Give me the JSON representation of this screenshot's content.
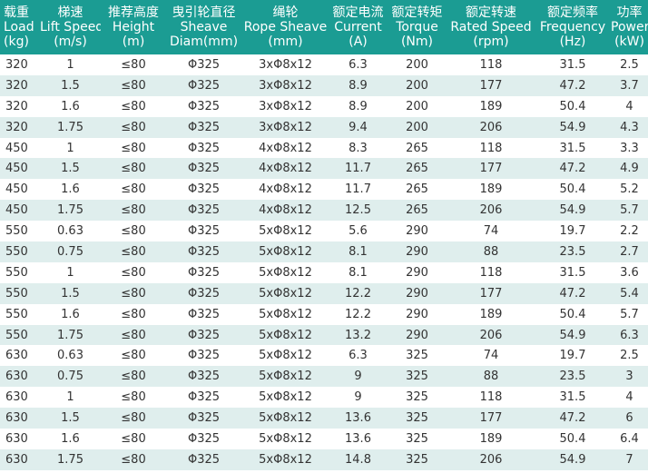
{
  "headers": [
    {
      "zh": "载重",
      "en1": "Load",
      "en2": "(kg)"
    },
    {
      "zh": "梯速",
      "en1": "Lift Speed",
      "en2": "(m/s)"
    },
    {
      "zh": "推荐高度",
      "en1": "Height",
      "en2": "(m)"
    },
    {
      "zh": "曳引轮直径",
      "en1": "Sheave",
      "en2": "Diam(mm)"
    },
    {
      "zh": "绳轮",
      "en1": "Rope Sheave",
      "en2": "(mm)"
    },
    {
      "zh": "额定电流",
      "en1": "Current",
      "en2": "(A)"
    },
    {
      "zh": "额定转矩",
      "en1": "Torque",
      "en2": "(Nm)"
    },
    {
      "zh": "额定转速",
      "en1": "Rated Speed",
      "en2": "(rpm)"
    },
    {
      "zh": "额定频率",
      "en1": "Frequency",
      "en2": "(Hz)"
    },
    {
      "zh": "功率",
      "en1": "Power",
      "en2": "(kW)"
    }
  ],
  "rows": [
    [
      "320",
      "1",
      "≤80",
      "Φ325",
      "3xΦ8x12",
      "6.3",
      "200",
      "118",
      "31.5",
      "2.5"
    ],
    [
      "320",
      "1.5",
      "≤80",
      "Φ325",
      "3xΦ8x12",
      "8.9",
      "200",
      "177",
      "47.2",
      "3.7"
    ],
    [
      "320",
      "1.6",
      "≤80",
      "Φ325",
      "3xΦ8x12",
      "8.9",
      "200",
      "189",
      "50.4",
      "4"
    ],
    [
      "320",
      "1.75",
      "≤80",
      "Φ325",
      "3xΦ8x12",
      "9.4",
      "200",
      "206",
      "54.9",
      "4.3"
    ],
    [
      "450",
      "1",
      "≤80",
      "Φ325",
      "4xΦ8x12",
      "8.3",
      "265",
      "118",
      "31.5",
      "3.3"
    ],
    [
      "450",
      "1.5",
      "≤80",
      "Φ325",
      "4xΦ8x12",
      "11.7",
      "265",
      "177",
      "47.2",
      "4.9"
    ],
    [
      "450",
      "1.6",
      "≤80",
      "Φ325",
      "4xΦ8x12",
      "11.7",
      "265",
      "189",
      "50.4",
      "5.2"
    ],
    [
      "450",
      "1.75",
      "≤80",
      "Φ325",
      "4xΦ8x12",
      "12.5",
      "265",
      "206",
      "54.9",
      "5.7"
    ],
    [
      "550",
      "0.63",
      "≤80",
      "Φ325",
      "5xΦ8x12",
      "5.6",
      "290",
      "74",
      "19.7",
      "2.2"
    ],
    [
      "550",
      "0.75",
      "≤80",
      "Φ325",
      "5xΦ8x12",
      "8.1",
      "290",
      "88",
      "23.5",
      "2.7"
    ],
    [
      "550",
      "1",
      "≤80",
      "Φ325",
      "5xΦ8x12",
      "8.1",
      "290",
      "118",
      "31.5",
      "3.6"
    ],
    [
      "550",
      "1.5",
      "≤80",
      "Φ325",
      "5xΦ8x12",
      "12.2",
      "290",
      "177",
      "47.2",
      "5.4"
    ],
    [
      "550",
      "1.6",
      "≤80",
      "Φ325",
      "5xΦ8x12",
      "12.2",
      "290",
      "189",
      "50.4",
      "5.7"
    ],
    [
      "550",
      "1.75",
      "≤80",
      "Φ325",
      "5xΦ8x12",
      "13.2",
      "290",
      "206",
      "54.9",
      "6.3"
    ],
    [
      "630",
      "0.63",
      "≤80",
      "Φ325",
      "5xΦ8x12",
      "6.3",
      "325",
      "74",
      "19.7",
      "2.5"
    ],
    [
      "630",
      "0.75",
      "≤80",
      "Φ325",
      "5xΦ8x12",
      "9",
      "325",
      "88",
      "23.5",
      "3"
    ],
    [
      "630",
      "1",
      "≤80",
      "Φ325",
      "5xΦ8x12",
      "9",
      "325",
      "118",
      "31.5",
      "4"
    ],
    [
      "630",
      "1.5",
      "≤80",
      "Φ325",
      "5xΦ8x12",
      "13.6",
      "325",
      "177",
      "47.2",
      "6"
    ],
    [
      "630",
      "1.6",
      "≤80",
      "Φ325",
      "5xΦ8x12",
      "13.6",
      "325",
      "189",
      "50.4",
      "6.4"
    ],
    [
      "630",
      "1.75",
      "≤80",
      "Φ325",
      "5xΦ8x12",
      "14.8",
      "325",
      "206",
      "54.9",
      "7"
    ]
  ],
  "colors": {
    "header_bg": "#1b9c93",
    "stripe_bg": "#dfeeed",
    "text": "#333333"
  }
}
